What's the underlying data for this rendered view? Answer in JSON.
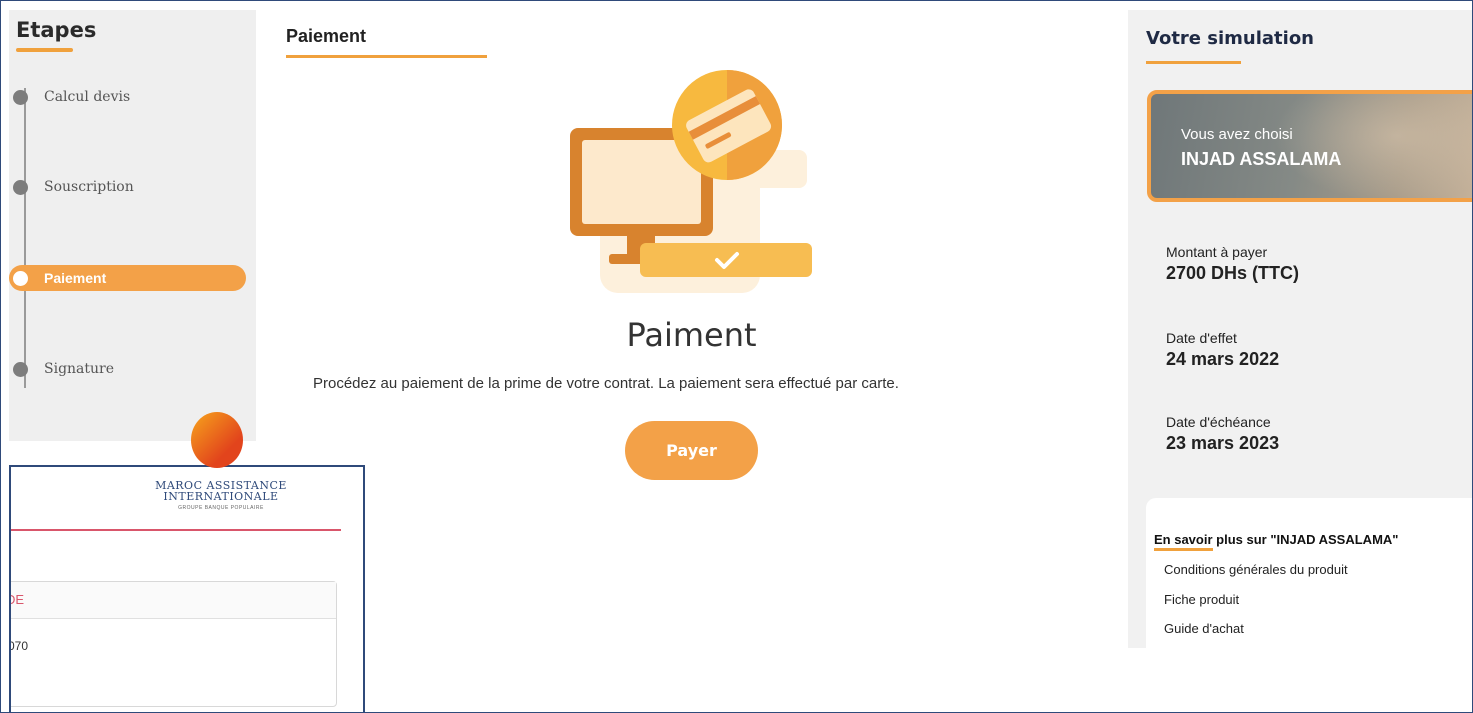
{
  "steps": {
    "title": "Etapes",
    "items": [
      {
        "label": "Calcul devis"
      },
      {
        "label": "Souscription"
      },
      {
        "label": "Paiement"
      },
      {
        "label": "Signature"
      }
    ]
  },
  "overlay_window": {
    "logo_line1": "MAROC ASSISTANCE",
    "logo_line2": "INTERNATIONALE",
    "logo_sub": "GROUPE BANQUE POPULAIRE",
    "card_header": "DE",
    "card_value": "070"
  },
  "main": {
    "section_title": "Paiement",
    "heading": "Paiment",
    "description": "Procédez au paiement de la prime de votre contrat. La paiement sera effectué par carte.",
    "pay_button": "Payer"
  },
  "simulation": {
    "title": "Votre simulation",
    "choice_prefix": "Vous avez choisi",
    "product": "INJAD ASSALAMA",
    "amount_label": "Montant à payer",
    "amount_value": "2700 DHs (TTC)",
    "effect_label": "Date d'effet",
    "effect_value": "24 mars 2022",
    "expiry_label": "Date d'échéance",
    "expiry_value": "23 mars 2023",
    "more_keyword": "En savoir",
    "more_rest": " plus sur \"INJAD ASSALAMA\"",
    "links": [
      "Conditions générales du produit",
      "Fiche produit",
      "Guide d'achat"
    ]
  },
  "colors": {
    "accent": "#f3a148",
    "border": "#2f4a7a"
  }
}
